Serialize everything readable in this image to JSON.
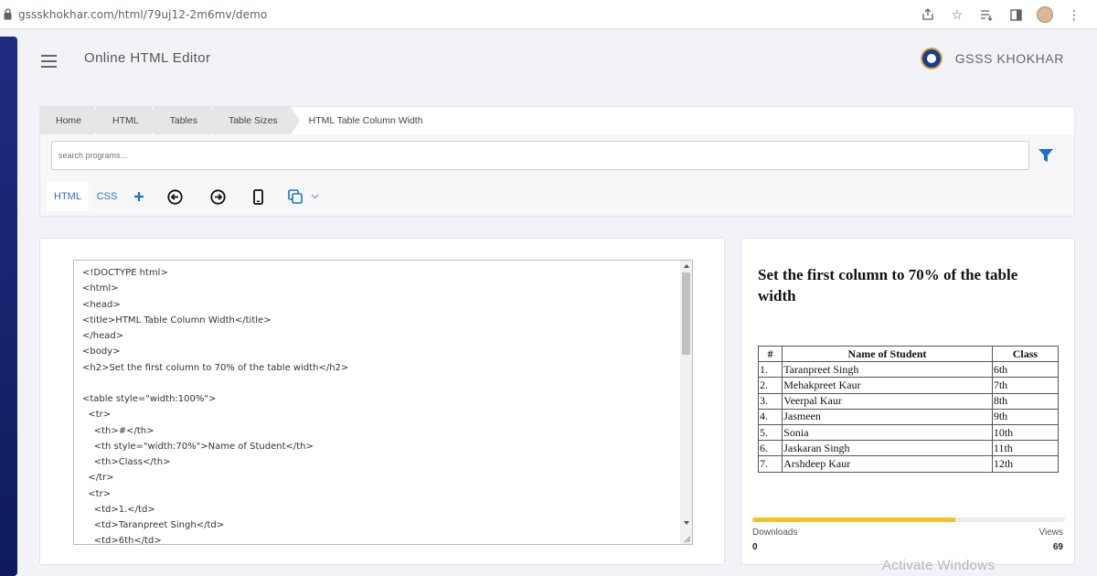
{
  "browser": {
    "url": "gssskhokhar.com/html/79uj12-2m6mv/demo"
  },
  "header": {
    "app_title": "Online HTML Editor",
    "brand_name": "GSSS KHOKHAR"
  },
  "breadcrumb": [
    "Home",
    "HTML",
    "Tables",
    "Table Sizes",
    "HTML Table Column Width"
  ],
  "search": {
    "placeholder": "search programs..."
  },
  "tabs": {
    "html_label": "HTML",
    "css_label": "CSS"
  },
  "editor": {
    "code_lines": [
      "<!DOCTYPE html>",
      "<html>",
      "<head>",
      "<title>HTML Table Column Width</title>",
      "</head>",
      "<body>",
      "<h2>Set the first column to 70% of the table width</h2>",
      "",
      "<table style=\"width:100%\">",
      "  <tr>",
      "    <th>#</th>",
      "    <th style=\"width:70%\">Name of Student</th>",
      "    <th>Class</th>",
      "  </tr>",
      "  <tr>",
      "    <td>1.</td>",
      "    <td>Taranpreet Singh</td>",
      "    <td>6th</td>"
    ]
  },
  "preview": {
    "heading": "Set the first column to 70% of the table width",
    "table": {
      "headers": [
        "#",
        "Name of Student",
        "Class"
      ],
      "rows": [
        [
          "1.",
          "Taranpreet Singh",
          "6th"
        ],
        [
          "2.",
          "Mehakpreet Kaur",
          "7th"
        ],
        [
          "3.",
          "Veerpal Kaur",
          "8th"
        ],
        [
          "4.",
          "Jasmeen",
          "9th"
        ],
        [
          "5.",
          "Sonia",
          "10th"
        ],
        [
          "6.",
          "Jaskaran Singh",
          "11th"
        ],
        [
          "7.",
          "Arshdeep Kaur",
          "12th"
        ]
      ]
    }
  },
  "stats": {
    "downloads_label": "Downloads",
    "downloads_value": "0",
    "views_label": "Views",
    "views_value": "69",
    "progress_fraction": 0.65
  },
  "colors": {
    "accent": "#1a73c9",
    "progress": "#f2c329",
    "sidebar": "#14246e"
  },
  "watermark": "Activate Windows"
}
